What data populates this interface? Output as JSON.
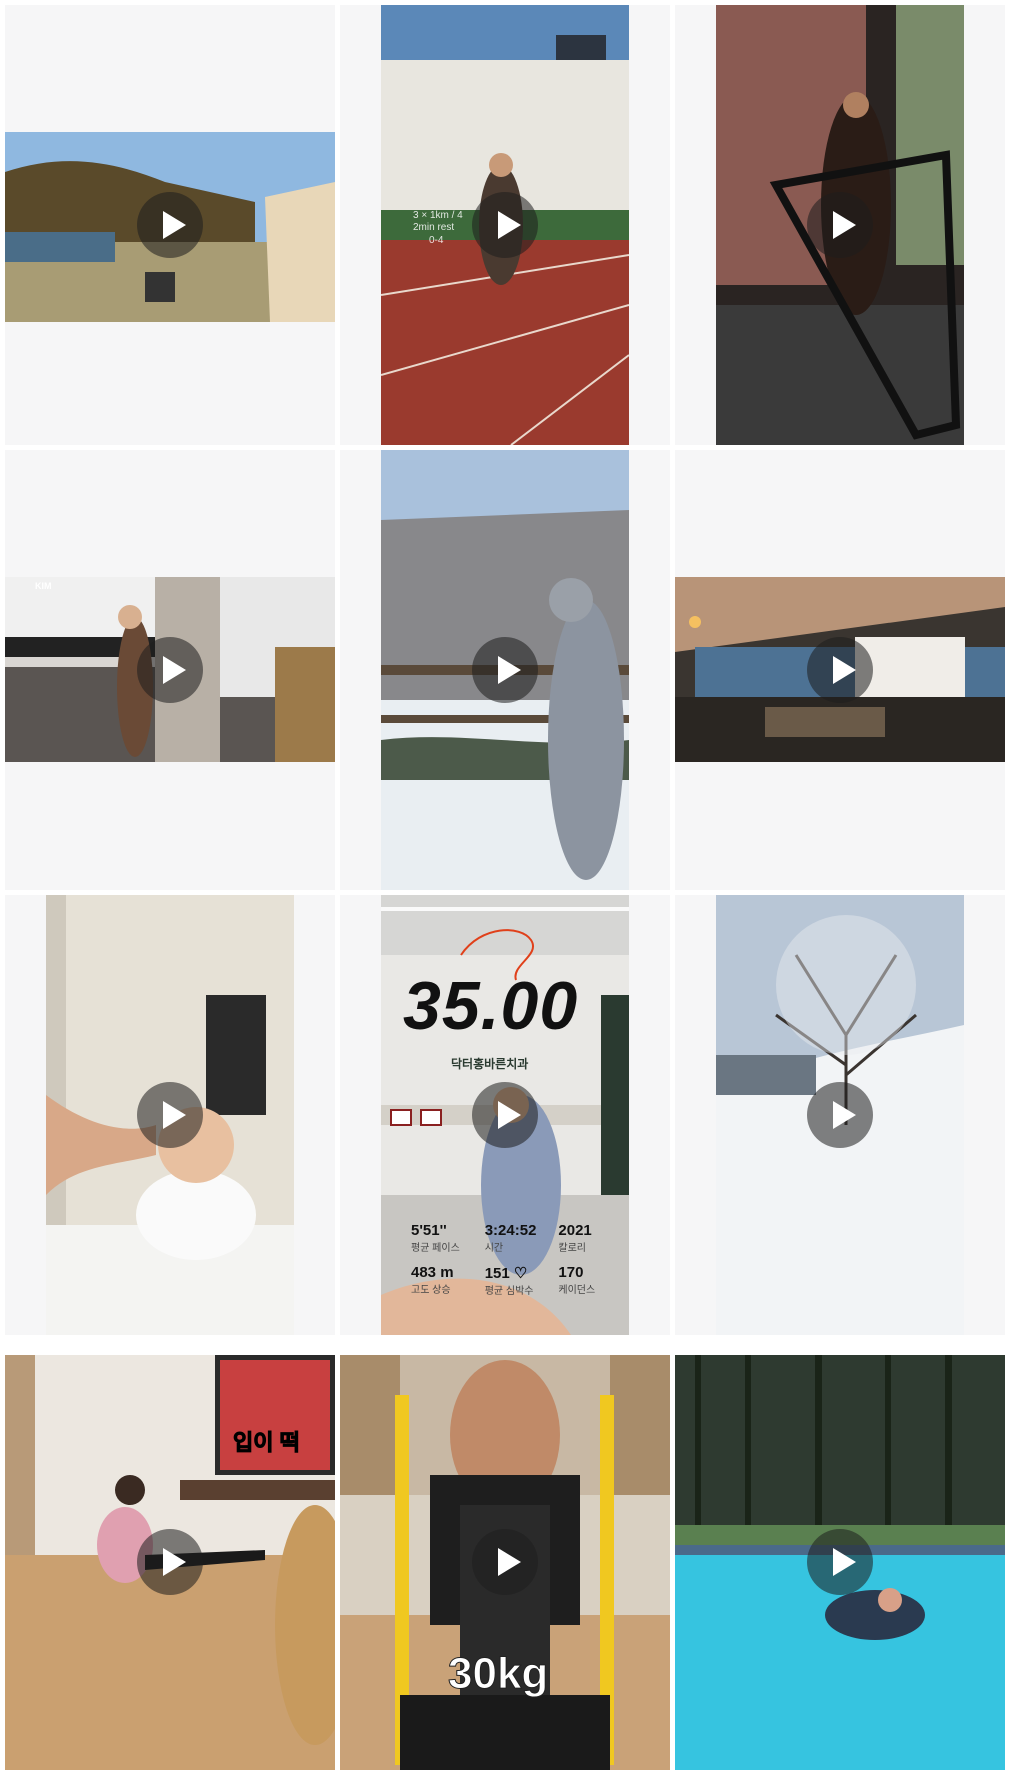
{
  "grid": {
    "posts": [
      {
        "type": "video",
        "play_icon": "play-icon",
        "description": "lake camp"
      },
      {
        "type": "video",
        "play_icon": "play-icon",
        "overlay": [
          "3 × 1km / 4",
          "2min rest",
          "0-4"
        ]
      },
      {
        "type": "video",
        "play_icon": "play-icon"
      },
      {
        "type": "video",
        "play_icon": "play-icon",
        "gym_sign": "KIM"
      },
      {
        "type": "video",
        "play_icon": "play-icon"
      },
      {
        "type": "video",
        "play_icon": "play-icon"
      },
      {
        "type": "video",
        "play_icon": "play-icon"
      },
      {
        "type": "video",
        "play_icon": "play-icon",
        "big_number": "35.00",
        "clinic_sign": "닥터홍바른치과",
        "stats": [
          {
            "value": "5'51''",
            "label": "평균 페이스"
          },
          {
            "value": "3:24:52",
            "label": "시간"
          },
          {
            "value": "2021",
            "label": "칼로리"
          },
          {
            "value": "483 m",
            "label": "고도 상승"
          },
          {
            "value": "151 ♡",
            "label": "평균 심박수"
          },
          {
            "value": "170",
            "label": "케이던스"
          }
        ]
      },
      {
        "type": "video",
        "play_icon": "play-icon"
      },
      {
        "type": "video",
        "play_icon": "play-icon",
        "tv_caption": "입이 떡"
      },
      {
        "type": "video",
        "play_icon": "play-icon",
        "weight_caption": "30kg"
      },
      {
        "type": "video",
        "play_icon": "play-icon"
      }
    ]
  },
  "colors": {
    "cell_bg": "#f6f6f7",
    "play_bg": "#1e1e1e"
  }
}
